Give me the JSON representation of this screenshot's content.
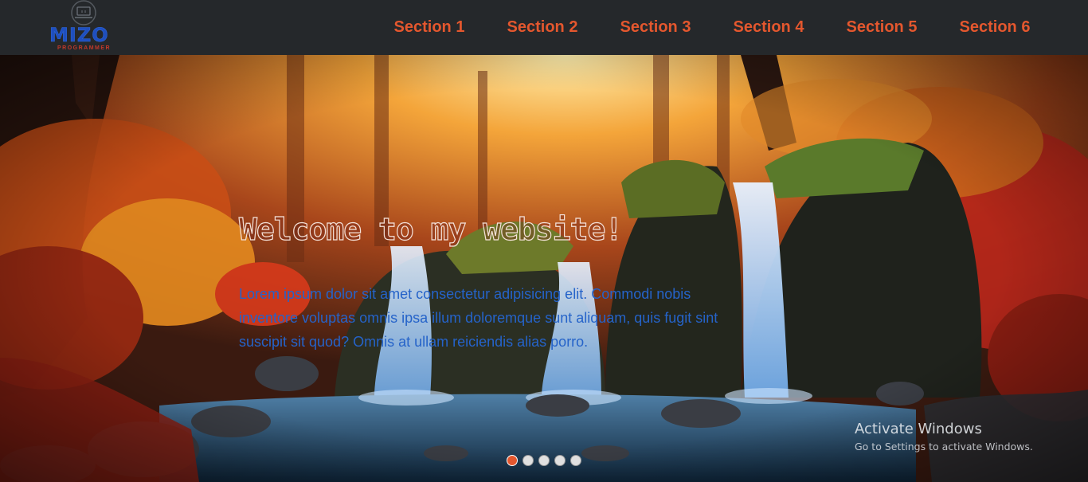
{
  "brand": {
    "name": "MIZO",
    "tagline": "PROGRAMMER"
  },
  "nav": {
    "items": [
      "Section 1",
      "Section 2",
      "Section 3",
      "Section 4",
      "Section 5",
      "Section 6"
    ]
  },
  "hero": {
    "title": "Welcome to my website!",
    "text": "Lorem ipsum dolor sit amet consectetur adipisicing elit. Commodi nobis inventore voluptas omnis ipsa illum doloremque sunt aliquam, quis fugit sint suscipit sit quod? Omnis at ullam reiciendis alias porro."
  },
  "slider": {
    "count": 5,
    "active_index": 0
  },
  "watermark": {
    "title": "Activate Windows",
    "subtitle": "Go to Settings to activate Windows."
  },
  "colors": {
    "navbar": "#25282b",
    "nav_link": "#e4572e",
    "brand_blue": "#1f4fbf",
    "hero_text": "#2563c9",
    "active_dot": "#e4572e"
  }
}
